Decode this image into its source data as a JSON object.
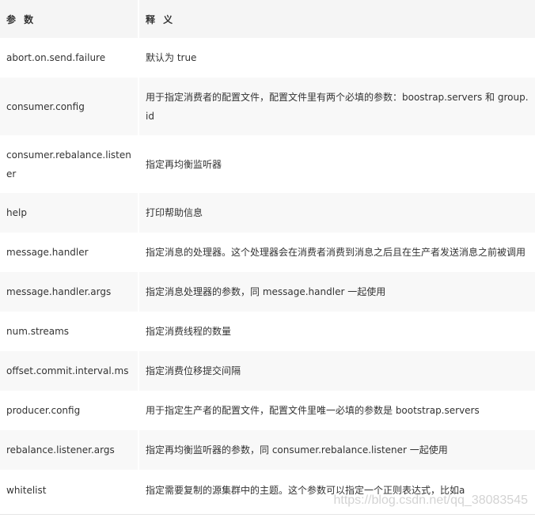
{
  "table": {
    "headers": [
      "参 数",
      "释 义"
    ],
    "rows": [
      {
        "param": "abort.on.send.failure",
        "desc": "默认为 true"
      },
      {
        "param": "consumer.config",
        "desc": "用于指定消费者的配置文件，配置文件里有两个必填的参数：boostrap.servers 和 group.id"
      },
      {
        "param": "consumer.rebalance.listener",
        "desc": "指定再均衡监听器"
      },
      {
        "param": "help",
        "desc": "打印帮助信息"
      },
      {
        "param": "message.handler",
        "desc": "指定消息的处理器。这个处理器会在消费者消费到消息之后且在生产者发送消息之前被调用"
      },
      {
        "param": "message.handler.args",
        "desc": "指定消息处理器的参数，同 message.handler 一起使用"
      },
      {
        "param": "num.streams",
        "desc": "指定消费线程的数量"
      },
      {
        "param": "offset.commit.interval.ms",
        "desc": "指定消费位移提交间隔"
      },
      {
        "param": "producer.config",
        "desc": "用于指定生产者的配置文件，配置文件里唯一必填的参数是 bootstrap.servers"
      },
      {
        "param": "rebalance.listener.args",
        "desc": "指定再均衡监听器的参数，同 consumer.rebalance.listener 一起使用"
      },
      {
        "param": "whitelist",
        "desc": "指定需要复制的源集群中的主题。这个参数可以指定一个正则表达式，比如a"
      }
    ]
  },
  "watermark": "https://blog.csdn.net/qq_38083545",
  "colors": {
    "header_bg": "#f5f5f5",
    "stripe_bg": "#f8f8f8",
    "text": "#333333",
    "watermark": "#afafaf"
  }
}
